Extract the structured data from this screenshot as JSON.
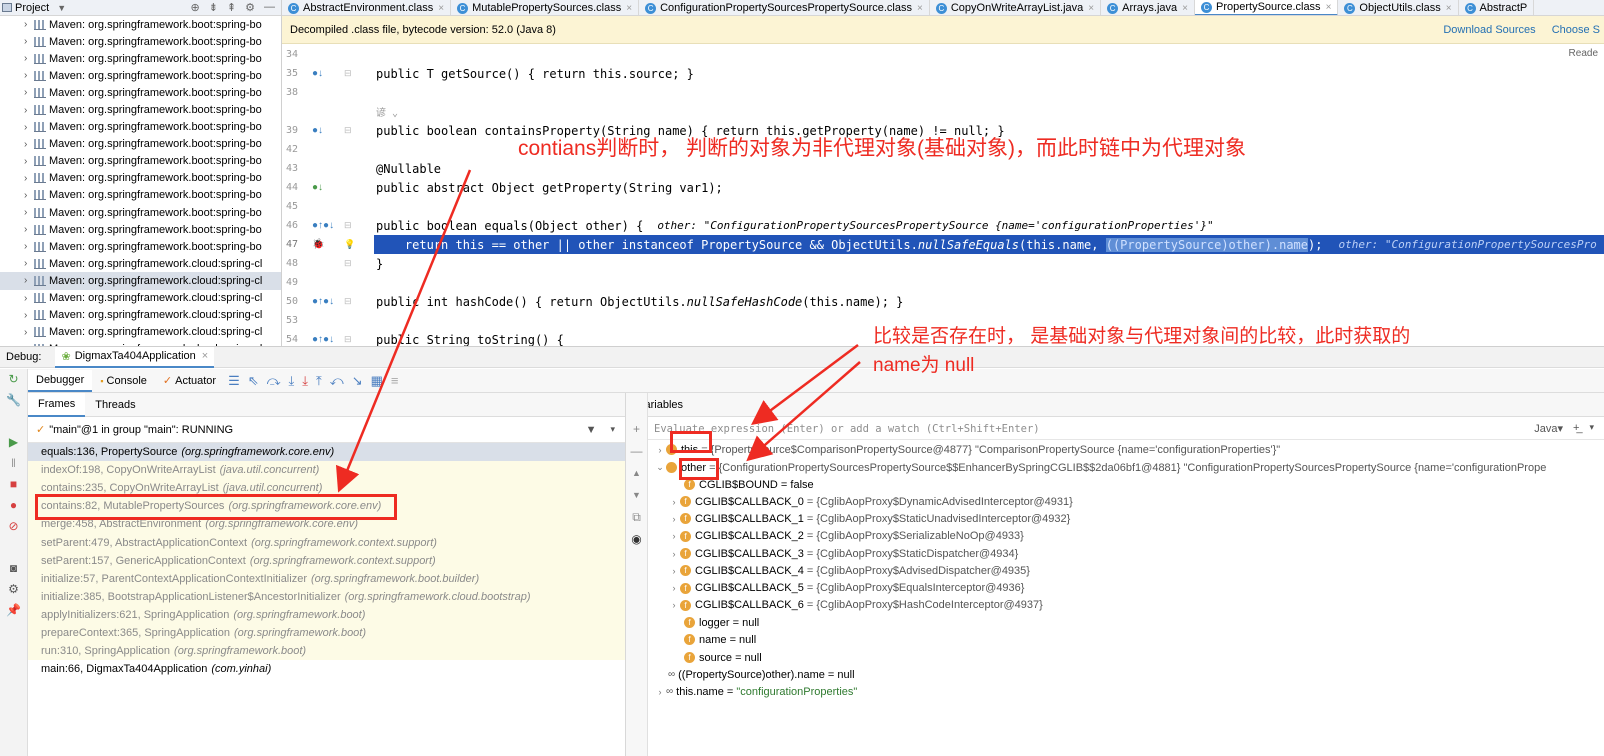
{
  "project": {
    "title": "Project",
    "items": [
      "Maven: org.springframework.boot:spring-bo",
      "Maven: org.springframework.boot:spring-bo",
      "Maven: org.springframework.boot:spring-bo",
      "Maven: org.springframework.boot:spring-bo",
      "Maven: org.springframework.boot:spring-bo",
      "Maven: org.springframework.boot:spring-bo",
      "Maven: org.springframework.boot:spring-bo",
      "Maven: org.springframework.boot:spring-bo",
      "Maven: org.springframework.boot:spring-bo",
      "Maven: org.springframework.boot:spring-bo",
      "Maven: org.springframework.boot:spring-bo",
      "Maven: org.springframework.boot:spring-bo",
      "Maven: org.springframework.boot:spring-bo",
      "Maven: org.springframework.boot:spring-bo",
      "Maven: org.springframework.cloud:spring-cl",
      "Maven: org.springframework.cloud:spring-cl",
      "Maven: org.springframework.cloud:spring-cl",
      "Maven: org.springframework.cloud:spring-cl",
      "Maven: org.springframework.cloud:spring-cl",
      "Maven: org.springframework.cloud:spring-cl"
    ],
    "selected_index": 15
  },
  "tabs": [
    "AbstractEnvironment.class",
    "MutablePropertySources.class",
    "ConfigurationPropertySourcesPropertySource.class",
    "CopyOnWriteArrayList.java",
    "Arrays.java",
    "PropertySource.class",
    "ObjectUtils.class",
    "AbstractP"
  ],
  "active_tab_index": 5,
  "decompiled": {
    "message": "Decompiled .class file, bytecode version: 52.0 (Java 8)",
    "download_sources": "Download Sources",
    "choose_sources": "Choose S",
    "reader": "Reade"
  },
  "code": {
    "line_numbers": [
      "34",
      "35",
      "38",
      "",
      "39",
      "42",
      "43",
      "44",
      "45",
      "46",
      "47",
      "48",
      "49",
      "50",
      "53",
      "54"
    ],
    "l35": "public T getSource() { return this.source; }",
    "l39a": "public boolean containsProperty(String name) { return this.getProperty(name) != null; }",
    "l43": "@Nullable",
    "l44": "public abstract Object getProperty(String var1);",
    "l46": "public boolean equals(Object other) {",
    "l46_hint": "other: \"ConfigurationPropertySourcesPropertySource {name='configurationProperties'}\"",
    "l47a": "    return this == other || other instanceof PropertySource && ObjectUtils.",
    "l47b": "nullSafeEquals",
    "l47c": "(this.name, ",
    "l47d": "((PropertySource)other).name",
    "l47e": ");",
    "l47_hint": "other: \"ConfigurationPropertySourcesPro",
    "l48": "}",
    "l50a": "public int hashCode() { return ObjectUtils.",
    "l50b": "nullSafeHashCode",
    "l50c": "(this.name); }",
    "l54": "public String toString() {",
    "inlay": "谚 ⌄"
  },
  "annotations": {
    "a1": "contians判断时， 判断的对象为非代理对象(基础对象)，而此时链中为代理对象",
    "a2_line1": "比较是否存在时， 是基础对象与代理对象间的比较，此时获取的",
    "a2_line2": "name为 null"
  },
  "debug": {
    "label": "Debug:",
    "app": "DigmaxTa404Application",
    "tabs": [
      "Debugger",
      "Console",
      "Actuator"
    ],
    "frames_tab": "Frames",
    "threads_tab": "Threads",
    "thread": "\"main\"@1 in group \"main\": RUNNING",
    "frames": [
      {
        "m": "equals:136, PropertySource",
        "p": "(org.springframework.core.env)"
      },
      {
        "m": "indexOf:198, CopyOnWriteArrayList",
        "p": "(java.util.concurrent)"
      },
      {
        "m": "contains:235, CopyOnWriteArrayList",
        "p": "(java.util.concurrent)"
      },
      {
        "m": "contains:82, MutablePropertySources",
        "p": "(org.springframework.core.env)"
      },
      {
        "m": "merge:458, AbstractEnvironment",
        "p": "(org.springframework.core.env)"
      },
      {
        "m": "setParent:479, AbstractApplicationContext",
        "p": "(org.springframework.context.support)"
      },
      {
        "m": "setParent:157, GenericApplicationContext",
        "p": "(org.springframework.context.support)"
      },
      {
        "m": "initialize:57, ParentContextApplicationContextInitializer",
        "p": "(org.springframework.boot.builder)"
      },
      {
        "m": "initialize:385, BootstrapApplicationListener$AncestorInitializer",
        "p": "(org.springframework.cloud.bootstrap)"
      },
      {
        "m": "applyInitializers:621, SpringApplication",
        "p": "(org.springframework.boot)"
      },
      {
        "m": "prepareContext:365, SpringApplication",
        "p": "(org.springframework.boot)"
      },
      {
        "m": "run:310, SpringApplication",
        "p": "(org.springframework.boot)"
      },
      {
        "m": "main:66, DigmaxTa404Application",
        "p": "(com.yinhai)"
      }
    ],
    "variables_title": "Variables",
    "eval_placeholder": "Evaluate expression (Enter) or add a watch (Ctrl+Shift+Enter)",
    "eval_lang": "Java▾",
    "vars": {
      "this_name": "this",
      "this_val": "= {PropertySource$ComparisonPropertySource@4877} \"ComparisonPropertySource {name='configurationProperties'}\"",
      "other_name": "other",
      "other_val": "= {ConfigurationPropertySourcesPropertySource$$EnhancerBySpringCGLIB$$2da06bf1@4881} \"ConfigurationPropertySourcesPropertySource {name='configurationPrope",
      "bound": "CGLIB$BOUND = false",
      "callbacks": [
        {
          "n": "CGLIB$CALLBACK_0",
          "v": "= {CglibAopProxy$DynamicAdvisedInterceptor@4931}"
        },
        {
          "n": "CGLIB$CALLBACK_1",
          "v": "= {CglibAopProxy$StaticUnadvisedInterceptor@4932}"
        },
        {
          "n": "CGLIB$CALLBACK_2",
          "v": "= {CglibAopProxy$SerializableNoOp@4933}"
        },
        {
          "n": "CGLIB$CALLBACK_3",
          "v": "= {CglibAopProxy$StaticDispatcher@4934}"
        },
        {
          "n": "CGLIB$CALLBACK_4",
          "v": "= {CglibAopProxy$AdvisedDispatcher@4935}"
        },
        {
          "n": "CGLIB$CALLBACK_5",
          "v": "= {CglibAopProxy$EqualsInterceptor@4936}"
        },
        {
          "n": "CGLIB$CALLBACK_6",
          "v": "= {CglibAopProxy$HashCodeInterceptor@4937}"
        }
      ],
      "logger": "logger = null",
      "name": "name = null",
      "source": "source = null",
      "watch1": "((PropertySource)other).name = null",
      "watch2_name": "this.name",
      "watch2_val": "\"configurationProperties\""
    }
  }
}
